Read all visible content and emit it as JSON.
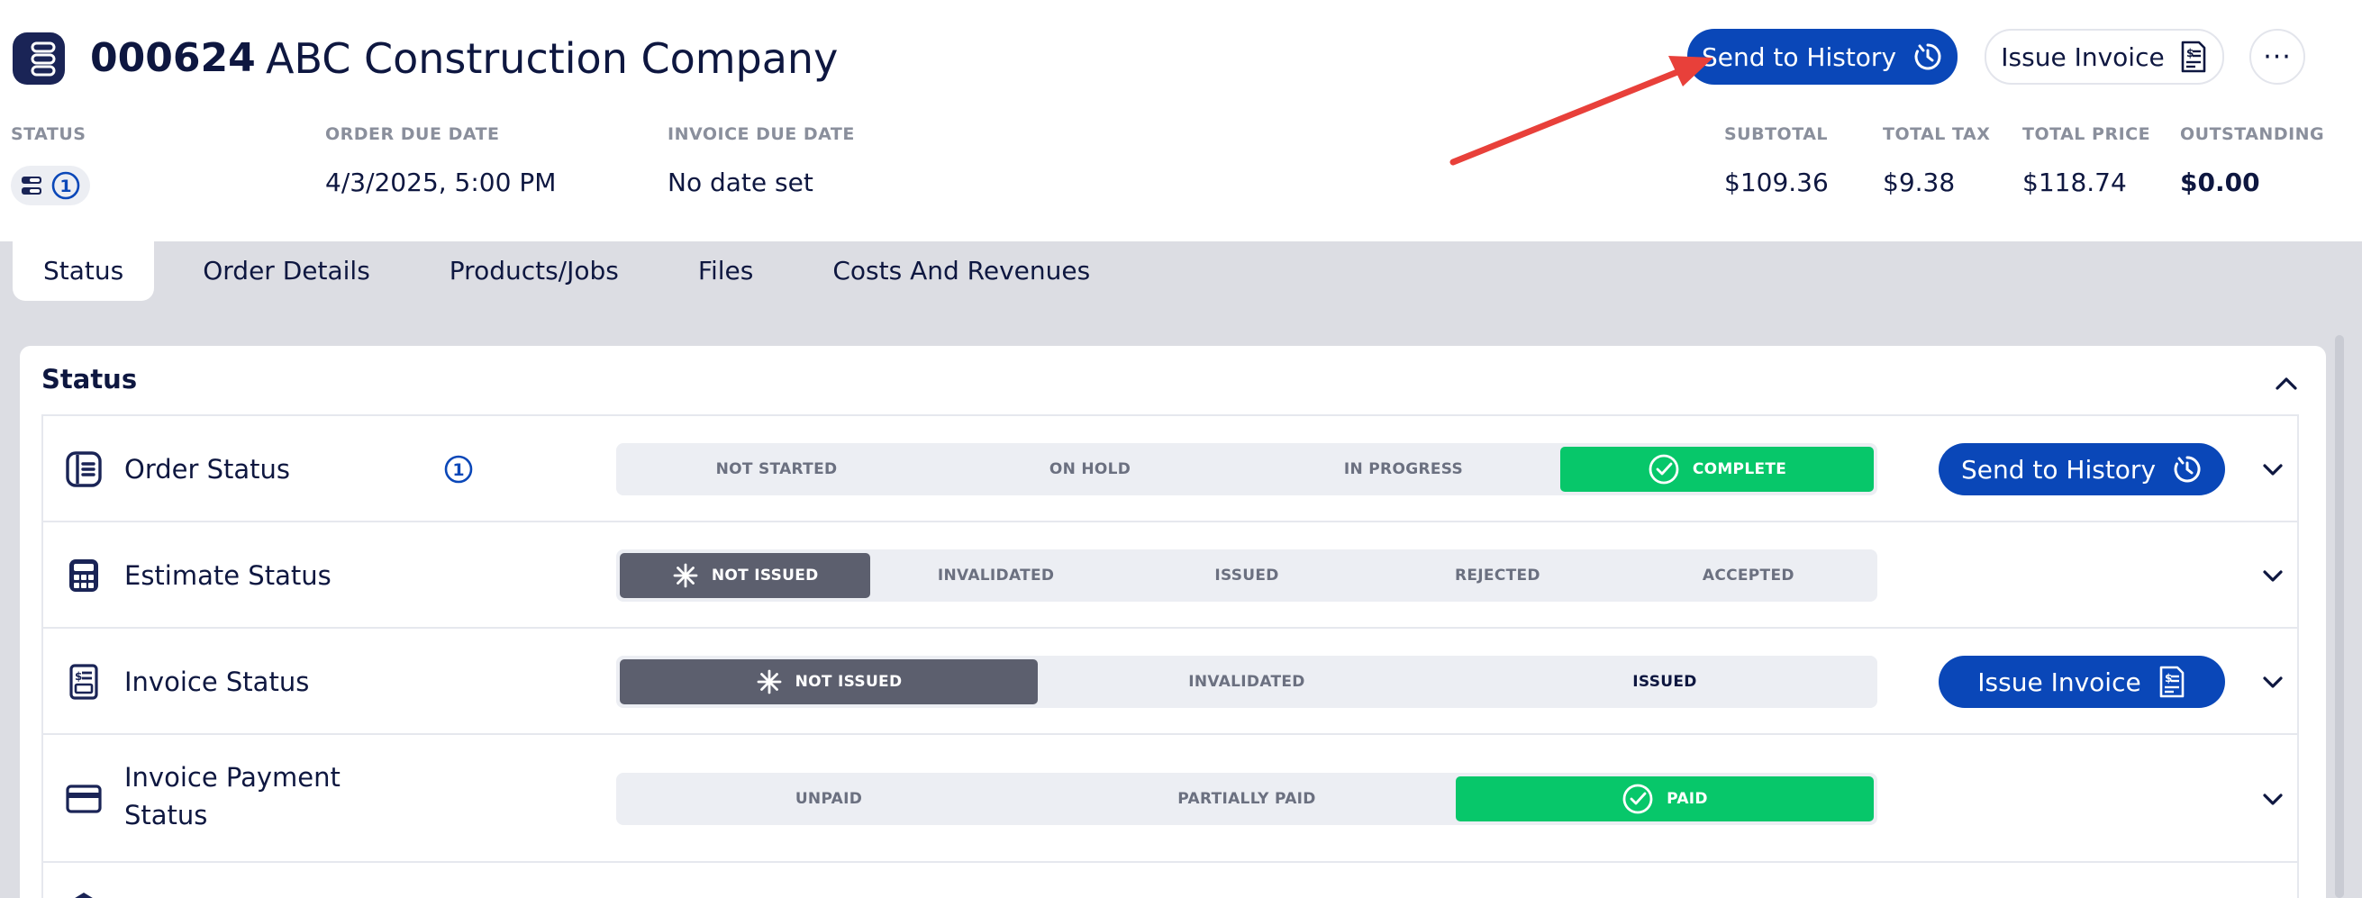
{
  "header": {
    "order_number": "000624",
    "company": "ABC Construction Company",
    "send_to_history_label": "Send to History",
    "issue_invoice_label": "Issue Invoice",
    "more_label": "···",
    "status_label": "STATUS",
    "status_count": "1",
    "order_due_label": "ORDER DUE DATE",
    "order_due_value": "4/3/2025, 5:00 PM",
    "invoice_due_label": "INVOICE DUE DATE",
    "invoice_due_value": "No date set",
    "subtotal_label": "SUBTOTAL",
    "subtotal_value": "$109.36",
    "tax_label": "TOTAL TAX",
    "tax_value": "$9.38",
    "price_label": "TOTAL PRICE",
    "price_value": "$118.74",
    "outstanding_label": "OUTSTANDING",
    "outstanding_value": "$0.00"
  },
  "tabs": [
    {
      "label": "Status",
      "active": true
    },
    {
      "label": "Order Details",
      "active": false
    },
    {
      "label": "Products/Jobs",
      "active": false
    },
    {
      "label": "Files",
      "active": false
    },
    {
      "label": "Costs And Revenues",
      "active": false
    }
  ],
  "card": {
    "title": "Status",
    "rows": [
      {
        "title": "Order Status",
        "badge": "1",
        "button_label": "Send to History",
        "segments": [
          "NOT STARTED",
          "ON HOLD",
          "IN PROGRESS",
          "COMPLETE"
        ],
        "active_segment": "COMPLETE"
      },
      {
        "title": "Estimate Status",
        "segments": [
          "NOT ISSUED",
          "INVALIDATED",
          "ISSUED",
          "REJECTED",
          "ACCEPTED"
        ],
        "active_segment": "NOT ISSUED"
      },
      {
        "title": "Invoice Status",
        "button_label": "Issue Invoice",
        "segments": [
          "NOT ISSUED",
          "INVALIDATED",
          "ISSUED"
        ],
        "active_segment": "NOT ISSUED"
      },
      {
        "title_line1": "Invoice Payment",
        "title_line2": "Status",
        "segments": [
          "UNPAID",
          "PARTIALLY PAID",
          "PAID"
        ],
        "active_segment": "PAID"
      }
    ]
  },
  "colors": {
    "brand_blue": "#0a47b8",
    "navy_text": "#0e1740",
    "complete_green": "#07c76a",
    "not_issued_grey": "#5c5f6e",
    "annotation_arrow": "#e8403a"
  }
}
